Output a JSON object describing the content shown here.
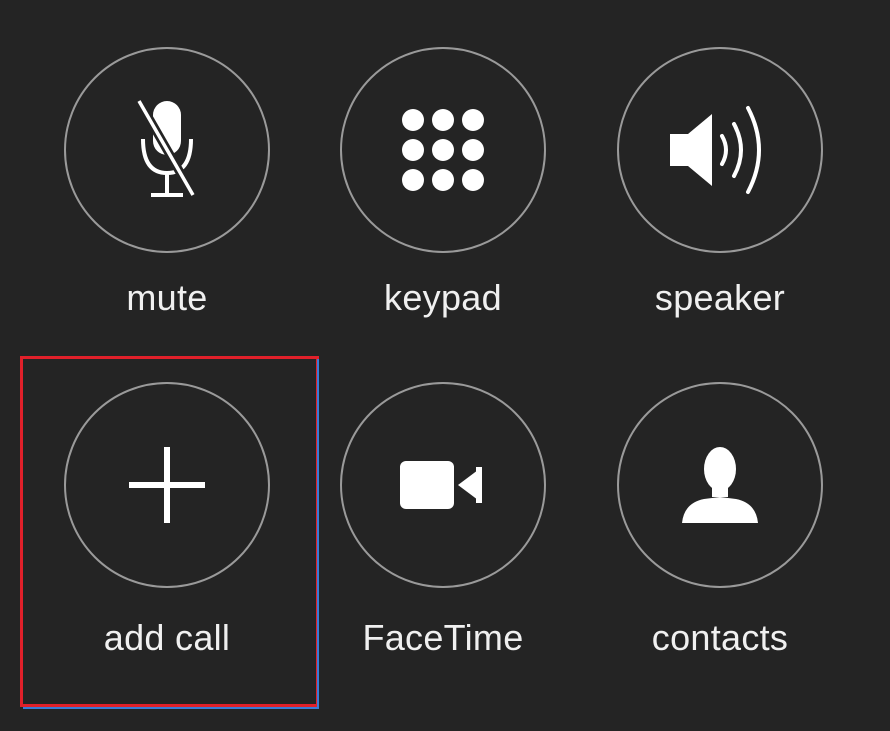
{
  "controls": {
    "mute": {
      "label": "mute",
      "icon": "microphone-muted-icon"
    },
    "keypad": {
      "label": "keypad",
      "icon": "keypad-grid-icon"
    },
    "speaker": {
      "label": "speaker",
      "icon": "speaker-icon"
    },
    "add_call": {
      "label": "add call",
      "icon": "plus-icon",
      "highlighted": true
    },
    "facetime": {
      "label": "FaceTime",
      "icon": "video-camera-icon"
    },
    "contacts": {
      "label": "contacts",
      "icon": "person-silhouette-icon"
    }
  },
  "colors": {
    "background": "#242424",
    "circle_border": "#9a9a9a",
    "icon": "#ffffff",
    "label": "#f0f0f0",
    "highlight_border": "#e0202a",
    "highlight_inner_border": "#3a7bd5"
  }
}
